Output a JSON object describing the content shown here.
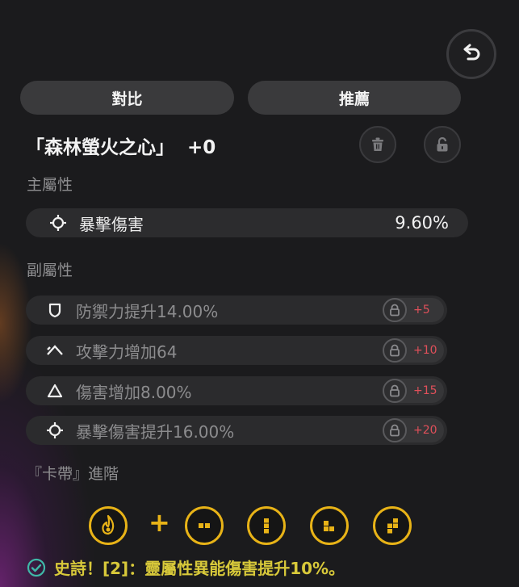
{
  "header": {
    "back_button_icon": "undo-arrow-icon"
  },
  "tabs": [
    {
      "label": "對比"
    },
    {
      "label": "推薦"
    }
  ],
  "item": {
    "name": "「森林螢火之心」",
    "level": "+0",
    "trash_icon": "trash-icon",
    "lock_icon": "lock-icon"
  },
  "main_stats": {
    "label": "主屬性",
    "items": [
      {
        "icon": "crit-target-icon",
        "name": "暴擊傷害",
        "value": "9.60%"
      }
    ]
  },
  "sub_stats": {
    "label": "副屬性",
    "items": [
      {
        "icon": "shield-icon",
        "name": "防禦力提升14.00%",
        "unlock_level": "+5"
      },
      {
        "icon": "chevron-up-icon",
        "name": "攻擊力增加64",
        "unlock_level": "+10"
      },
      {
        "icon": "triangle-icon",
        "name": "傷害增加8.00%",
        "unlock_level": "+15"
      },
      {
        "icon": "crit-target-icon",
        "name": "暴擊傷害提升16.00%",
        "unlock_level": "+20"
      }
    ]
  },
  "card_fusion": {
    "label": "『卡帶』進階",
    "plus_symbol": "+",
    "slots": [
      "flame-core-icon",
      "block-slot-1-icon",
      "block-slot-2-icon",
      "block-slot-3-icon",
      "block-slot-4-icon"
    ],
    "accent_color": "#e8b317"
  },
  "set_bonus": {
    "icon": "check-circle-icon",
    "text": "史詩！[2]：靈屬性異能傷害提升10%。"
  }
}
